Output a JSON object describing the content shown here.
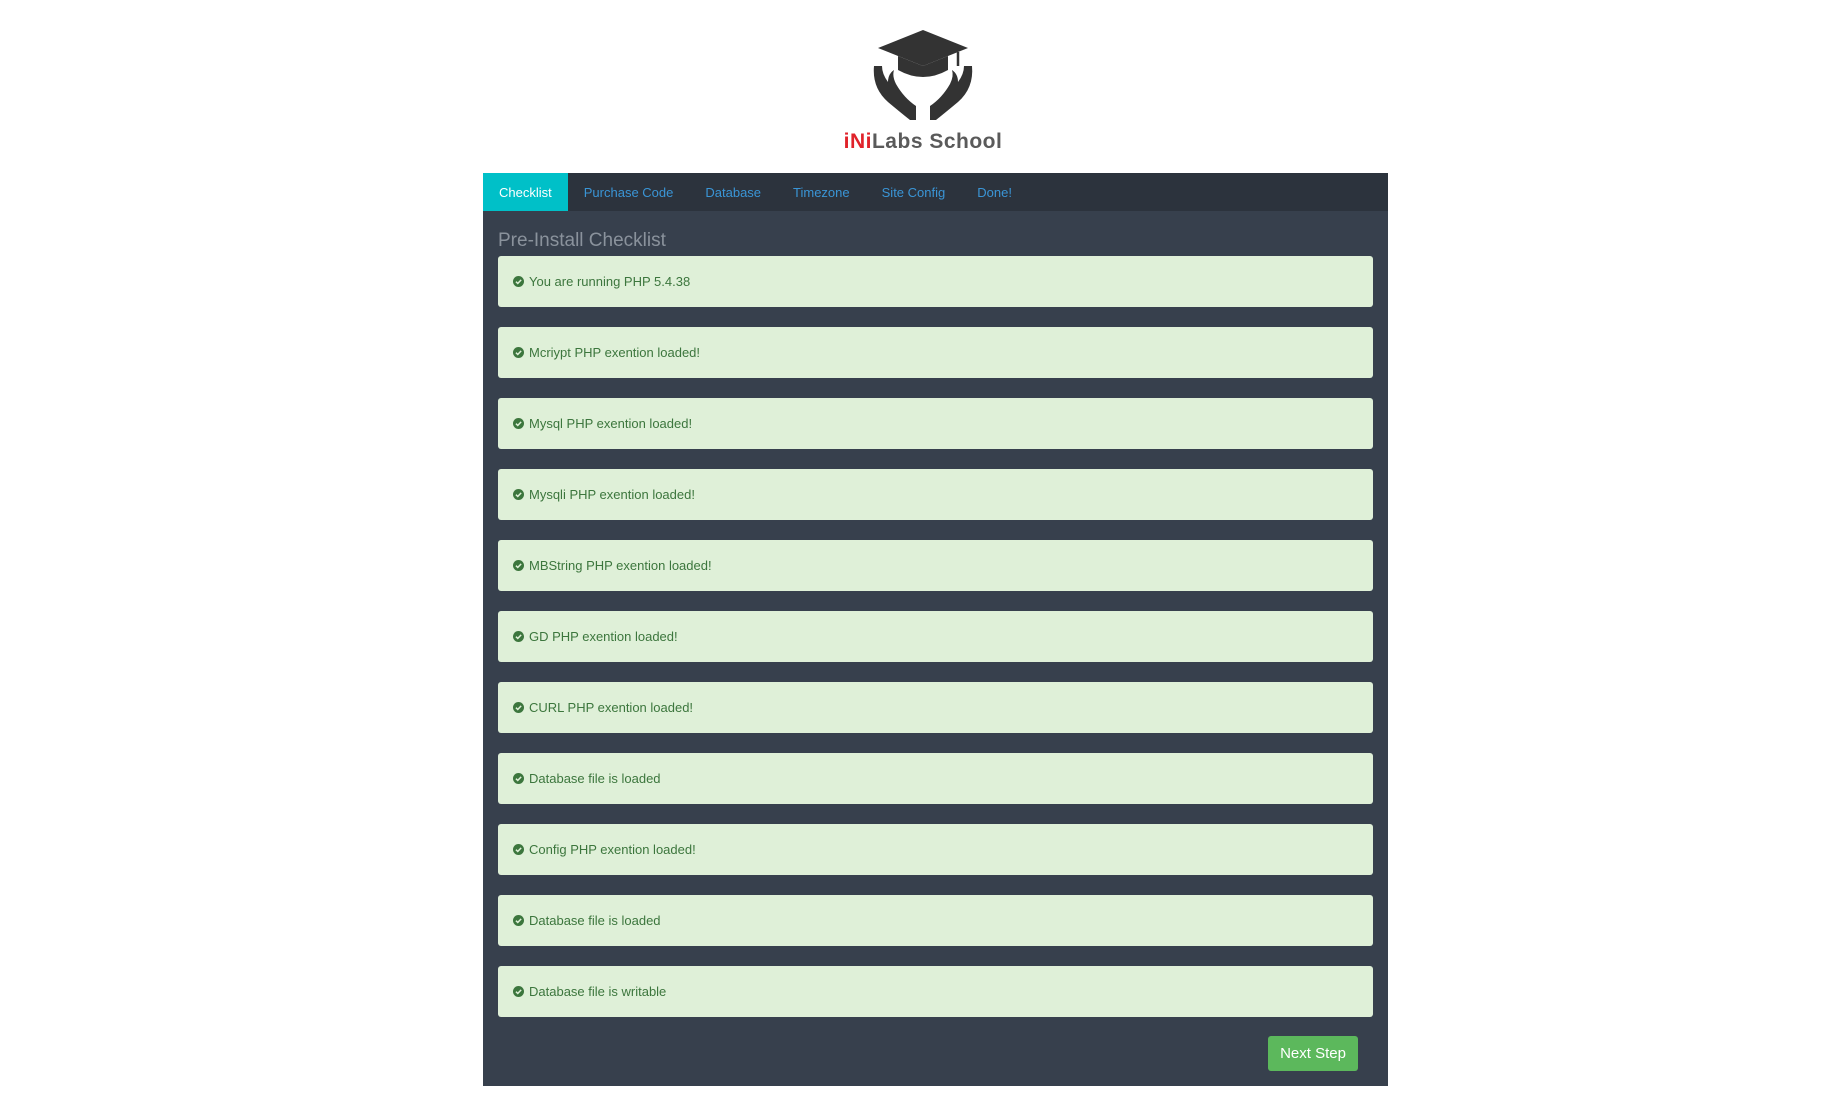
{
  "brand": {
    "accent": "iNi",
    "rest": "Labs School",
    "logo_icon": "graduation-cap-hands-icon"
  },
  "tabs": [
    {
      "label": "Checklist",
      "active": true
    },
    {
      "label": "Purchase Code",
      "active": false
    },
    {
      "label": "Database",
      "active": false
    },
    {
      "label": "Timezone",
      "active": false
    },
    {
      "label": "Site Config",
      "active": false
    },
    {
      "label": "Done!",
      "active": false
    }
  ],
  "panel": {
    "title": "Pre-Install Checklist"
  },
  "checklist": [
    {
      "icon": "check-circle-icon",
      "text": "You are running PHP 5.4.38"
    },
    {
      "icon": "check-circle-icon",
      "text": "Mcriypt PHP exention loaded!"
    },
    {
      "icon": "check-circle-icon",
      "text": "Mysql PHP exention loaded!"
    },
    {
      "icon": "check-circle-icon",
      "text": "Mysqli PHP exention loaded!"
    },
    {
      "icon": "check-circle-icon",
      "text": "MBString PHP exention loaded!"
    },
    {
      "icon": "check-circle-icon",
      "text": "GD PHP exention loaded!"
    },
    {
      "icon": "check-circle-icon",
      "text": "CURL PHP exention loaded!"
    },
    {
      "icon": "check-circle-icon",
      "text": "Database file is loaded"
    },
    {
      "icon": "check-circle-icon",
      "text": "Config PHP exention loaded!"
    },
    {
      "icon": "check-circle-icon",
      "text": "Database file is loaded"
    },
    {
      "icon": "check-circle-icon",
      "text": "Database file is writable"
    }
  ],
  "actions": {
    "next_label": "Next Step"
  },
  "colors": {
    "panel_bg": "#37404d",
    "tab_bar_bg": "#2c333d",
    "active_tab": "#00c0c8",
    "tab_link": "#3a95d6",
    "success_bg": "#dff0d8",
    "success_text": "#3c763d",
    "next_button": "#5cb85c",
    "brand_accent": "#e0222a"
  }
}
